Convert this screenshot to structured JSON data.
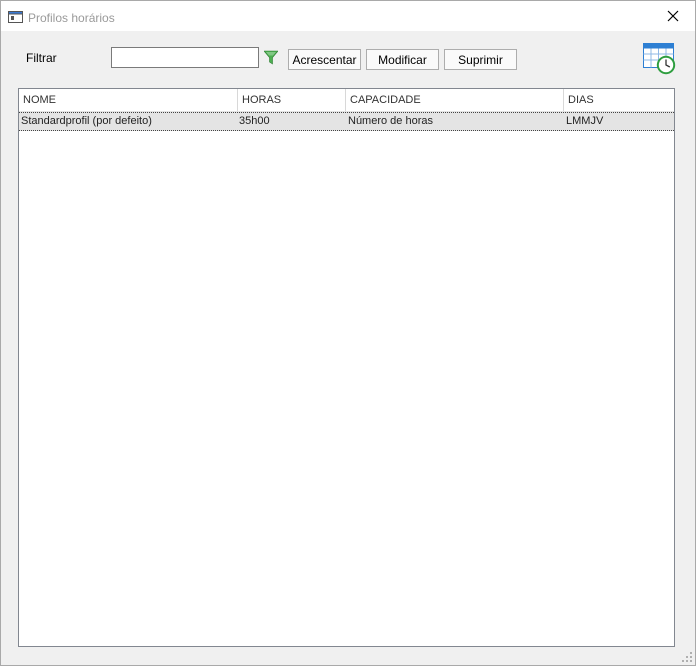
{
  "window": {
    "title": "Profilos horários"
  },
  "toolbar": {
    "filter_label": "Filtrar",
    "filter_value": "",
    "filter_placeholder": "",
    "add_label": "Acrescentar",
    "modify_label": "Modificar",
    "delete_label": "Suprimir"
  },
  "icons": {
    "app": "window-app-icon",
    "close": "close-icon",
    "filter": "funnel-filter-icon",
    "calendar": "calendar-clock-icon",
    "filter_color": "#4caf50",
    "calendar_color": "#2d7fd3",
    "clock_color": "#2e9e3f"
  },
  "table": {
    "columns": [
      "NOME",
      "HORAS",
      "CAPACIDADE",
      "DIAS"
    ],
    "rows": [
      {
        "nome": "Standardprofil (por defeito)",
        "horas": "35h00",
        "capacidade": "Número de horas",
        "dias": "LMMJV",
        "selected": true
      }
    ]
  }
}
